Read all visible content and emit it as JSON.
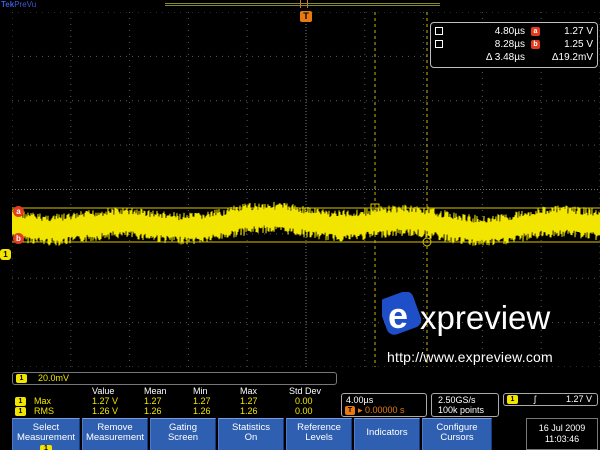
{
  "header": {
    "brand": "Tek",
    "state": "PreVu"
  },
  "channel": {
    "marker": "1",
    "color": "#f2e600",
    "scale": "20.0mV"
  },
  "trigger_marker": "T",
  "cursor_markers": {
    "a": "a",
    "b": "b"
  },
  "cursor_readout": {
    "time_a": "4.80µs",
    "time_b": "8.28µs",
    "delta_time": "Δ 3.48µs",
    "badge_a": "a",
    "badge_b": "b",
    "value_a": "1.27 V",
    "value_b": "1.25 V",
    "delta_value": "Δ19.2mV"
  },
  "watermark": {
    "logo_letter": "e",
    "logo_text": "xpreview",
    "url": "http://www.expreview.com",
    "colors": {
      "logo_blue": "#1e4fc8",
      "text": "#ffffff"
    }
  },
  "measurements": {
    "headers": [
      "Value",
      "Mean",
      "Min",
      "Max",
      "Std Dev"
    ],
    "rows": [
      {
        "source": "1",
        "name": "Max",
        "values": [
          "1.27 V",
          "1.27",
          "1.27",
          "1.27",
          "0.00"
        ]
      },
      {
        "source": "1",
        "name": "RMS",
        "values": [
          "1.26 V",
          "1.26",
          "1.26",
          "1.26",
          "0.00"
        ]
      }
    ]
  },
  "horizontal": {
    "scale": "4.00µs",
    "trig_chip": "T",
    "delay": "▸ 0.00000 s"
  },
  "acquisition": {
    "rate": "2.50GS/s",
    "record": "100k points"
  },
  "trigger": {
    "source": "1",
    "slope": "ʃ",
    "level": "1.27 V"
  },
  "softkeys": [
    {
      "line1": "Select",
      "line2": "Measurement",
      "chip": "1"
    },
    {
      "line1": "Remove",
      "line2": "Measurement"
    },
    {
      "line1": "Gating",
      "line2": "Screen"
    },
    {
      "line1": "Statistics",
      "line2": "On"
    },
    {
      "line1": "Reference",
      "line2": "Levels"
    },
    {
      "line1": "Indicators"
    },
    {
      "line1": "Configure",
      "line2": "Cursors"
    }
  ],
  "datetime": {
    "date": "16 Jul  2009",
    "time": "11:03:46"
  }
}
